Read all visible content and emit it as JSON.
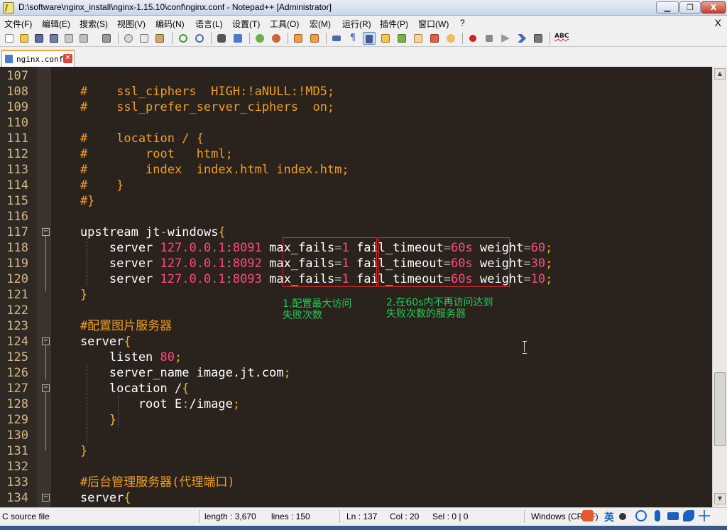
{
  "window": {
    "title": "D:\\software\\nginx_install\\nginx-1.15.10\\conf\\nginx.conf - Notepad++ [Administrator]",
    "buttons": [
      "▁",
      "❐",
      "X"
    ]
  },
  "menu": {
    "items": [
      "文件(F)",
      "编辑(E)",
      "搜索(S)",
      "视图(V)",
      "编码(N)",
      "语言(L)",
      "设置(T)",
      "工具(O)",
      "宏(M)",
      "运行(R)",
      "插件(P)",
      "窗口(W)",
      "?"
    ],
    "close": "X"
  },
  "toolbar": {
    "spellcheck_label": "ABC",
    "icons": [
      "new-file-icon",
      "open-file-icon",
      "save-icon",
      "save-all-icon",
      "close-icon",
      "close-all-icon",
      "print-icon",
      "cut-icon",
      "copy-icon",
      "paste-icon",
      "undo-icon",
      "redo-icon",
      "find-icon",
      "replace-icon",
      "zoom-in-icon",
      "zoom-out-icon",
      "sync-v-icon",
      "sync-h-icon",
      "wrap-icon",
      "all-chars-icon",
      "indent-guide-icon",
      "udl-icon",
      "doc-map-icon",
      "function-list-icon",
      "folder-workspace-icon",
      "monitor-icon",
      "record-macro-icon",
      "stop-macro-icon",
      "play-macro-icon",
      "run-macro-multiple-icon",
      "save-macro-icon"
    ]
  },
  "tabs": [
    {
      "label": "nginx.conf",
      "close": "✕"
    }
  ],
  "editor": {
    "lines": [
      {
        "n": "107",
        "segs": []
      },
      {
        "n": "108",
        "segs": [
          [
            "c-com",
            "    #    ssl_ciphers  HIGH:!aNULL:!MD5;"
          ]
        ]
      },
      {
        "n": "109",
        "segs": [
          [
            "c-com",
            "    #    ssl_prefer_server_ciphers  on;"
          ]
        ]
      },
      {
        "n": "110",
        "segs": []
      },
      {
        "n": "111",
        "segs": [
          [
            "c-com",
            "    #    location / {"
          ]
        ]
      },
      {
        "n": "112",
        "segs": [
          [
            "c-com",
            "    #        root   html;"
          ]
        ]
      },
      {
        "n": "113",
        "segs": [
          [
            "c-com",
            "    #        index  index.html index.htm;"
          ]
        ]
      },
      {
        "n": "114",
        "segs": [
          [
            "c-com",
            "    #    }"
          ]
        ]
      },
      {
        "n": "115",
        "segs": [
          [
            "c-com",
            "    #}"
          ]
        ]
      },
      {
        "n": "116",
        "segs": []
      },
      {
        "n": "117",
        "segs": [
          [
            "c-kw",
            "    upstream jt"
          ],
          [
            "c-op",
            "-"
          ],
          [
            "c-kw",
            "windows"
          ],
          [
            "c-br",
            "{"
          ]
        ]
      },
      {
        "n": "118",
        "segs": [
          [
            "c-kw",
            "        server "
          ],
          [
            "c-ip",
            "127.0.0.1"
          ],
          [
            "c-op",
            ":"
          ],
          [
            "c-num",
            "8091"
          ],
          [
            "c-kw",
            " max_fails"
          ],
          [
            "c-op",
            "="
          ],
          [
            "c-num",
            "1"
          ],
          [
            "c-kw",
            " fail_timeout"
          ],
          [
            "c-op",
            "="
          ],
          [
            "c-num",
            "60s"
          ],
          [
            "c-kw",
            " weight"
          ],
          [
            "c-op",
            "="
          ],
          [
            "c-num",
            "60"
          ],
          [
            "c-br",
            ";"
          ]
        ]
      },
      {
        "n": "119",
        "segs": [
          [
            "c-kw",
            "        server "
          ],
          [
            "c-ip",
            "127.0.0.1"
          ],
          [
            "c-op",
            ":"
          ],
          [
            "c-num",
            "8092"
          ],
          [
            "c-kw",
            " max_fails"
          ],
          [
            "c-op",
            "="
          ],
          [
            "c-num",
            "1"
          ],
          [
            "c-kw",
            " fail_timeout"
          ],
          [
            "c-op",
            "="
          ],
          [
            "c-num",
            "60s"
          ],
          [
            "c-kw",
            " weight"
          ],
          [
            "c-op",
            "="
          ],
          [
            "c-num",
            "30"
          ],
          [
            "c-br",
            ";"
          ]
        ]
      },
      {
        "n": "120",
        "segs": [
          [
            "c-kw",
            "        server "
          ],
          [
            "c-ip",
            "127.0.0.1"
          ],
          [
            "c-op",
            ":"
          ],
          [
            "c-num",
            "8093"
          ],
          [
            "c-kw",
            " max_fails"
          ],
          [
            "c-op",
            "="
          ],
          [
            "c-num",
            "1"
          ],
          [
            "c-kw",
            " fail_timeout"
          ],
          [
            "c-op",
            "="
          ],
          [
            "c-num",
            "60s"
          ],
          [
            "c-kw",
            " weight"
          ],
          [
            "c-op",
            "="
          ],
          [
            "c-num",
            "10"
          ],
          [
            "c-br",
            ";"
          ]
        ]
      },
      {
        "n": "121",
        "segs": [
          [
            "c-br",
            "    }"
          ]
        ]
      },
      {
        "n": "122",
        "segs": []
      },
      {
        "n": "123",
        "segs": [
          [
            "c-com",
            "    #配置图片服务器"
          ]
        ]
      },
      {
        "n": "124",
        "segs": [
          [
            "c-kw",
            "    server"
          ],
          [
            "c-br",
            "{"
          ]
        ]
      },
      {
        "n": "125",
        "segs": [
          [
            "c-kw",
            "        listen "
          ],
          [
            "c-num",
            "80"
          ],
          [
            "c-br",
            ";"
          ]
        ]
      },
      {
        "n": "126",
        "segs": [
          [
            "c-kw",
            "        server_name image.jt.com"
          ],
          [
            "c-br",
            ";"
          ]
        ]
      },
      {
        "n": "127",
        "segs": [
          [
            "c-kw",
            "        location /"
          ],
          [
            "c-br",
            "{"
          ]
        ]
      },
      {
        "n": "128",
        "segs": [
          [
            "c-kw",
            "            root E"
          ],
          [
            "c-op",
            ":"
          ],
          [
            "c-kw",
            "/image"
          ],
          [
            "c-br",
            ";"
          ]
        ]
      },
      {
        "n": "129",
        "segs": [
          [
            "c-br",
            "        }"
          ]
        ]
      },
      {
        "n": "130",
        "segs": []
      },
      {
        "n": "131",
        "segs": [
          [
            "c-br",
            "    }"
          ]
        ]
      },
      {
        "n": "132",
        "segs": []
      },
      {
        "n": "133",
        "segs": [
          [
            "c-com",
            "    #后台管理服务器(代理端口)"
          ]
        ]
      },
      {
        "n": "134",
        "segs": [
          [
            "c-kw",
            "    server"
          ],
          [
            "c-br",
            "{"
          ]
        ]
      }
    ],
    "annotations": {
      "max_fails": "1.配置最大访问\n失败次数",
      "fail_timeout": "2.在60s内不再访问达到\n失败次数的服务器"
    }
  },
  "status": {
    "file_type": "C source file",
    "length": "length : 3,670",
    "lines": "lines : 150",
    "ln": "Ln : 137",
    "col": "Col : 20",
    "sel": "Sel : 0 | 0",
    "eol": "Windows (CR LF)",
    "ime_label": "英"
  },
  "colors": {
    "editor_bg": "#2a221d",
    "comment": "#f0a020",
    "number": "#ff4a7f",
    "annotation": "#22cc55",
    "highlight_box": "#e02828"
  }
}
